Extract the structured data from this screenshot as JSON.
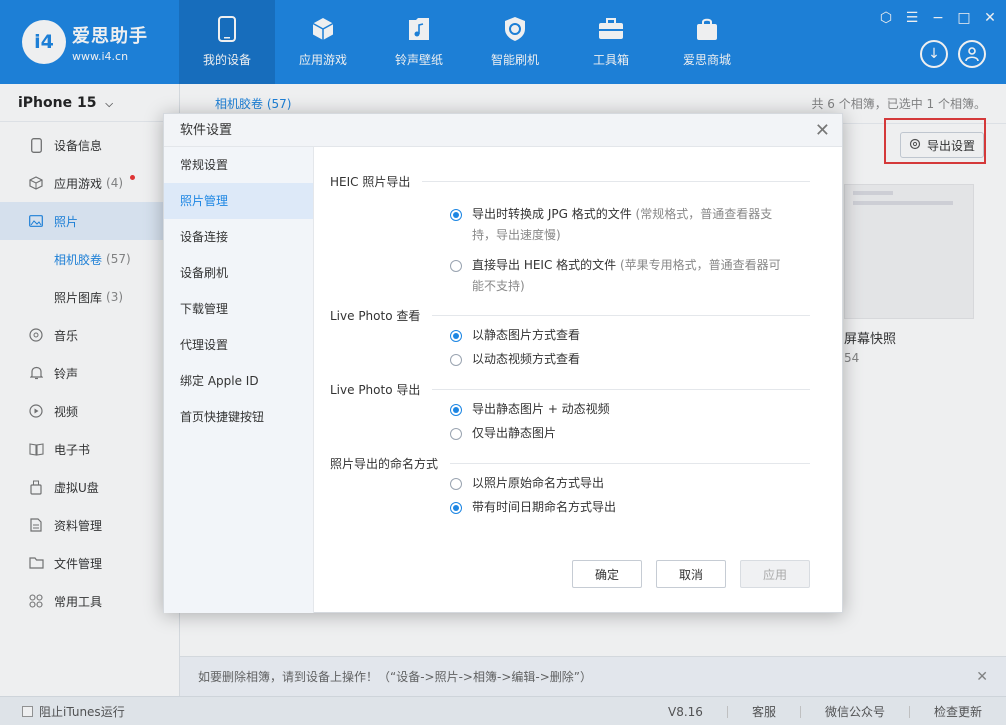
{
  "app": {
    "logo_badge": "i4",
    "logo_name": "爱思助手",
    "logo_url": "www.i4.cn"
  },
  "nav": [
    {
      "label": "我的设备",
      "icon": "phone-icon",
      "active": true
    },
    {
      "label": "应用游戏",
      "icon": "cube-icon",
      "active": false
    },
    {
      "label": "铃声壁纸",
      "icon": "music-file-icon",
      "active": false
    },
    {
      "label": "智能刷机",
      "icon": "refresh-shield-icon",
      "active": false
    },
    {
      "label": "工具箱",
      "icon": "toolbox-icon",
      "active": false
    },
    {
      "label": "爱思商城",
      "icon": "shopping-bag-icon",
      "active": false
    }
  ],
  "sidebar": {
    "device": "iPhone 15",
    "items": [
      {
        "label": "设备信息",
        "icon": "device-info-icon"
      },
      {
        "label": "应用游戏",
        "count": "(4)",
        "icon": "app-cube-icon",
        "dot": true
      },
      {
        "label": "照片",
        "icon": "photo-icon",
        "active": true
      },
      {
        "label": "相机胶卷",
        "count": "(57)",
        "sub": true,
        "active": true
      },
      {
        "label": "照片图库",
        "count": "(3)",
        "sub": true
      },
      {
        "label": "音乐",
        "icon": "music-disc-icon"
      },
      {
        "label": "铃声",
        "icon": "bell-icon"
      },
      {
        "label": "视频",
        "icon": "video-play-icon"
      },
      {
        "label": "电子书",
        "icon": "book-icon"
      },
      {
        "label": "虚拟U盘",
        "icon": "usb-drive-icon"
      },
      {
        "label": "资料管理",
        "icon": "document-icon"
      },
      {
        "label": "文件管理",
        "icon": "folder-icon"
      },
      {
        "label": "常用工具",
        "icon": "tools-grid-icon"
      }
    ]
  },
  "main": {
    "album_tab": "相机胶卷 (57)",
    "summary": "共 6 个相簿，已选中 1 个相簿。",
    "export_label": "导出设置",
    "thumb_title": "屏幕快照",
    "thumb_count": "54",
    "tip": "如要删除相簿，请到设备上操作！（“设备->照片->相簿->编辑->删除”）"
  },
  "statusbar": {
    "itunes_label": "阻止iTunes运行",
    "version": "V8.16",
    "service": "客服",
    "wechat": "微信公众号",
    "update": "检查更新"
  },
  "dialog": {
    "title": "软件设置",
    "nav": [
      {
        "label": "常规设置"
      },
      {
        "label": "照片管理",
        "active": true
      },
      {
        "label": "设备连接"
      },
      {
        "label": "设备刷机"
      },
      {
        "label": "下载管理"
      },
      {
        "label": "代理设置"
      },
      {
        "label": "绑定 Apple ID"
      },
      {
        "label": "首页快捷键按钮"
      }
    ],
    "sections": {
      "heic": {
        "title": "HEIC 照片导出",
        "opt1": "导出时转换成 JPG 格式的文件",
        "opt1_hint": " (常规格式，普通查看器支持，导出速度慢)",
        "opt2": "直接导出 HEIC 格式的文件",
        "opt2_hint": " (苹果专用格式，普通查看器可能不支持)"
      },
      "live_view": {
        "title": "Live Photo 查看",
        "opt1": "以静态图片方式查看",
        "opt2": "以动态视频方式查看"
      },
      "live_export": {
        "title": "Live Photo 导出",
        "opt1": "导出静态图片 + 动态视频",
        "opt2": "仅导出静态图片"
      },
      "naming": {
        "title": "照片导出的命名方式",
        "opt1": "以照片原始命名方式导出",
        "opt2": "带有时间日期命名方式导出"
      }
    },
    "buttons": {
      "ok": "确定",
      "cancel": "取消",
      "apply": "应用"
    }
  }
}
